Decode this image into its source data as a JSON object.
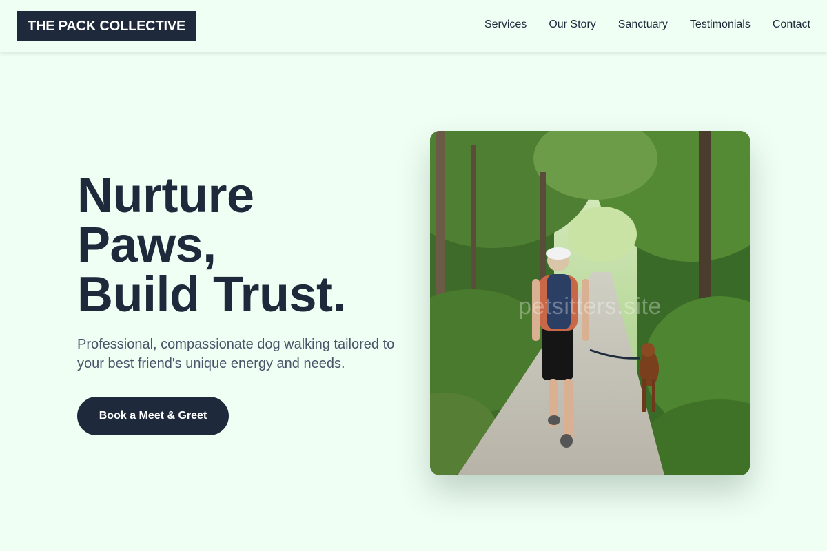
{
  "header": {
    "logo_text": "THE PACK COLLECTIVE",
    "nav": [
      {
        "label": "Services"
      },
      {
        "label": "Our Story"
      },
      {
        "label": "Sanctuary"
      },
      {
        "label": "Testimonials"
      },
      {
        "label": "Contact"
      }
    ]
  },
  "hero": {
    "headline_lines": [
      "Nurture",
      "Paws,",
      "Build Trust."
    ],
    "subtitle": "Professional, compassionate dog walking tailored to your best friend's unique energy and needs.",
    "cta_label": "Book a Meet & Greet",
    "image": {
      "description_icon": "photo-woman-walking-dog-forest",
      "watermark": "petsitters.site"
    }
  },
  "colors": {
    "background": "#f0fff4",
    "primary": "#1e293b",
    "muted_text": "#475569",
    "white": "#ffffff"
  }
}
